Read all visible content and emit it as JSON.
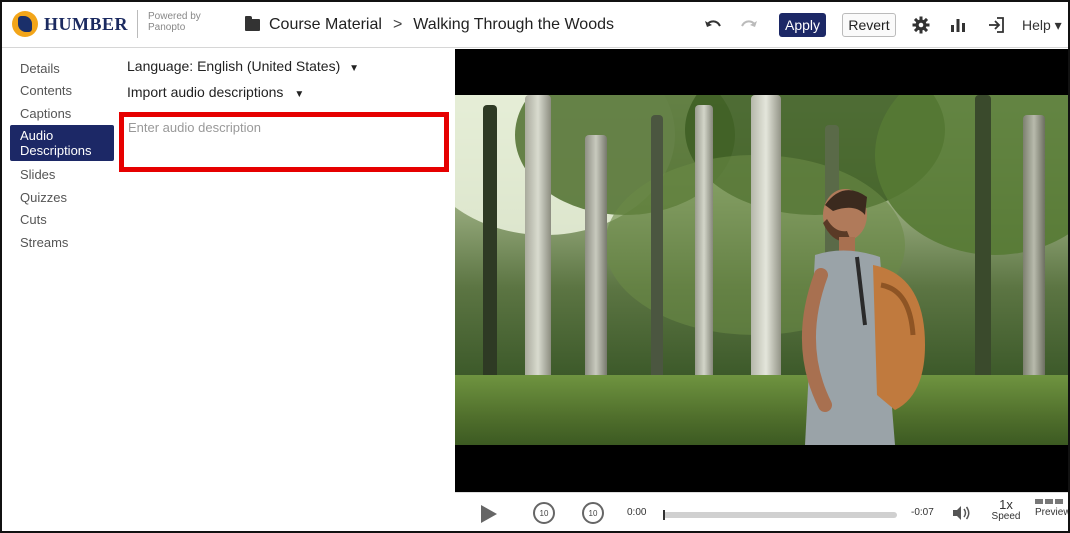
{
  "header": {
    "brand": "HUMBER",
    "powered_by": "Powered by",
    "powered_by_product": "Panopto",
    "breadcrumb_folder": "Course Material",
    "breadcrumb_separator": ">",
    "session_title": "Walking Through the Woods",
    "apply_label": "Apply",
    "revert_label": "Revert",
    "help_label": "Help ▾",
    "icons": [
      "undo-icon",
      "redo-icon",
      "gear-icon",
      "stats-icon",
      "exit-icon",
      "folder-icon"
    ]
  },
  "sidebar": {
    "items": [
      {
        "label": "Details",
        "active": false
      },
      {
        "label": "Contents",
        "active": false
      },
      {
        "label": "Captions",
        "active": false
      },
      {
        "label": "Audio Descriptions",
        "active": true
      },
      {
        "label": "Slides",
        "active": false
      },
      {
        "label": "Quizzes",
        "active": false
      },
      {
        "label": "Cuts",
        "active": false
      },
      {
        "label": "Streams",
        "active": false
      }
    ]
  },
  "panel": {
    "language_label": "Language: English (United States)",
    "import_label": "Import audio descriptions",
    "input_placeholder": "Enter audio description",
    "input_value": ""
  },
  "player": {
    "current_time": "0:00",
    "remaining_time": "-0:07",
    "progress": 0,
    "skip_back_label": "10",
    "skip_forward_label": "10",
    "speed_value": "1x",
    "speed_label": "Speed",
    "preview_label": "Preview"
  },
  "colors": {
    "accent": "#1c2866",
    "highlight": "#e60000",
    "brand_gold": "#f2a51a"
  }
}
